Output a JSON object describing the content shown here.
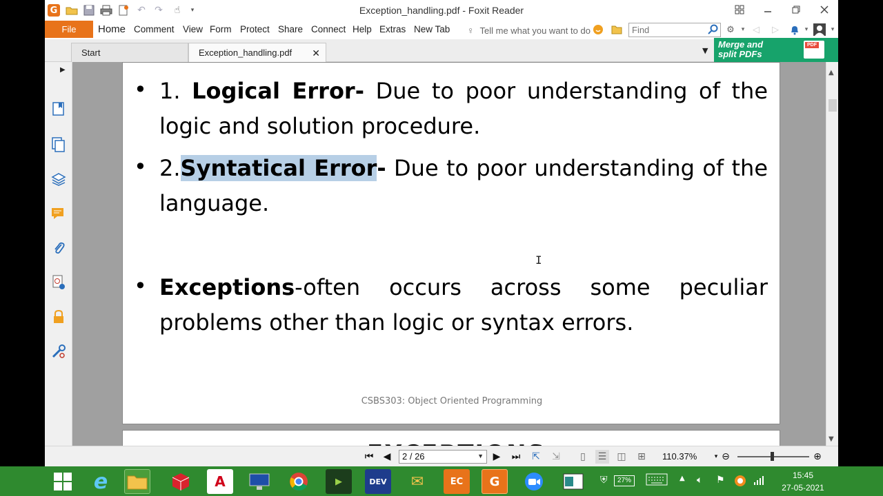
{
  "window": {
    "title": "Exception_handling.pdf - Foxit Reader"
  },
  "menubar": {
    "file": "File",
    "items": [
      "Home",
      "Comment",
      "View",
      "Form",
      "Protect",
      "Share",
      "Connect",
      "Help",
      "Extras",
      "New Tab"
    ],
    "tell_me": "Tell me what you want to do",
    "find_placeholder": "Find"
  },
  "tabs": [
    {
      "label": "Start"
    },
    {
      "label": "Exception_handling.pdf",
      "active": true
    }
  ],
  "ad": {
    "line1": "Merge and",
    "line2": "split PDFs",
    "badge": "PDF"
  },
  "document": {
    "item1": {
      "prefix": "1. ",
      "bold": "Logical Error-",
      "text": " Due to poor understanding of the logic and solution procedure."
    },
    "item2": {
      "prefix": "2.",
      "bold_highlighted": "Syntatical Error",
      "bold_rest": "-",
      "text": " Due to poor understanding of the language."
    },
    "item3": {
      "bold": "Exceptions",
      "text": "-often occurs across some peculiar problems other than logic or syntax errors."
    },
    "footer": "CSBS303: Object Oriented Programming",
    "next_page_heading": "EXCEPTIONS"
  },
  "statusbar": {
    "page_indicator": "2 / 26",
    "zoom_level": "110.37%"
  },
  "taskbar": {
    "battery": "27%",
    "time": "15:45",
    "date": "27-05-2021"
  },
  "colors": {
    "foxit_orange": "#e8731a",
    "highlight": "#b7cfe6",
    "taskbar_green": "#2f8a2f",
    "ad_green": "#17a36b"
  }
}
